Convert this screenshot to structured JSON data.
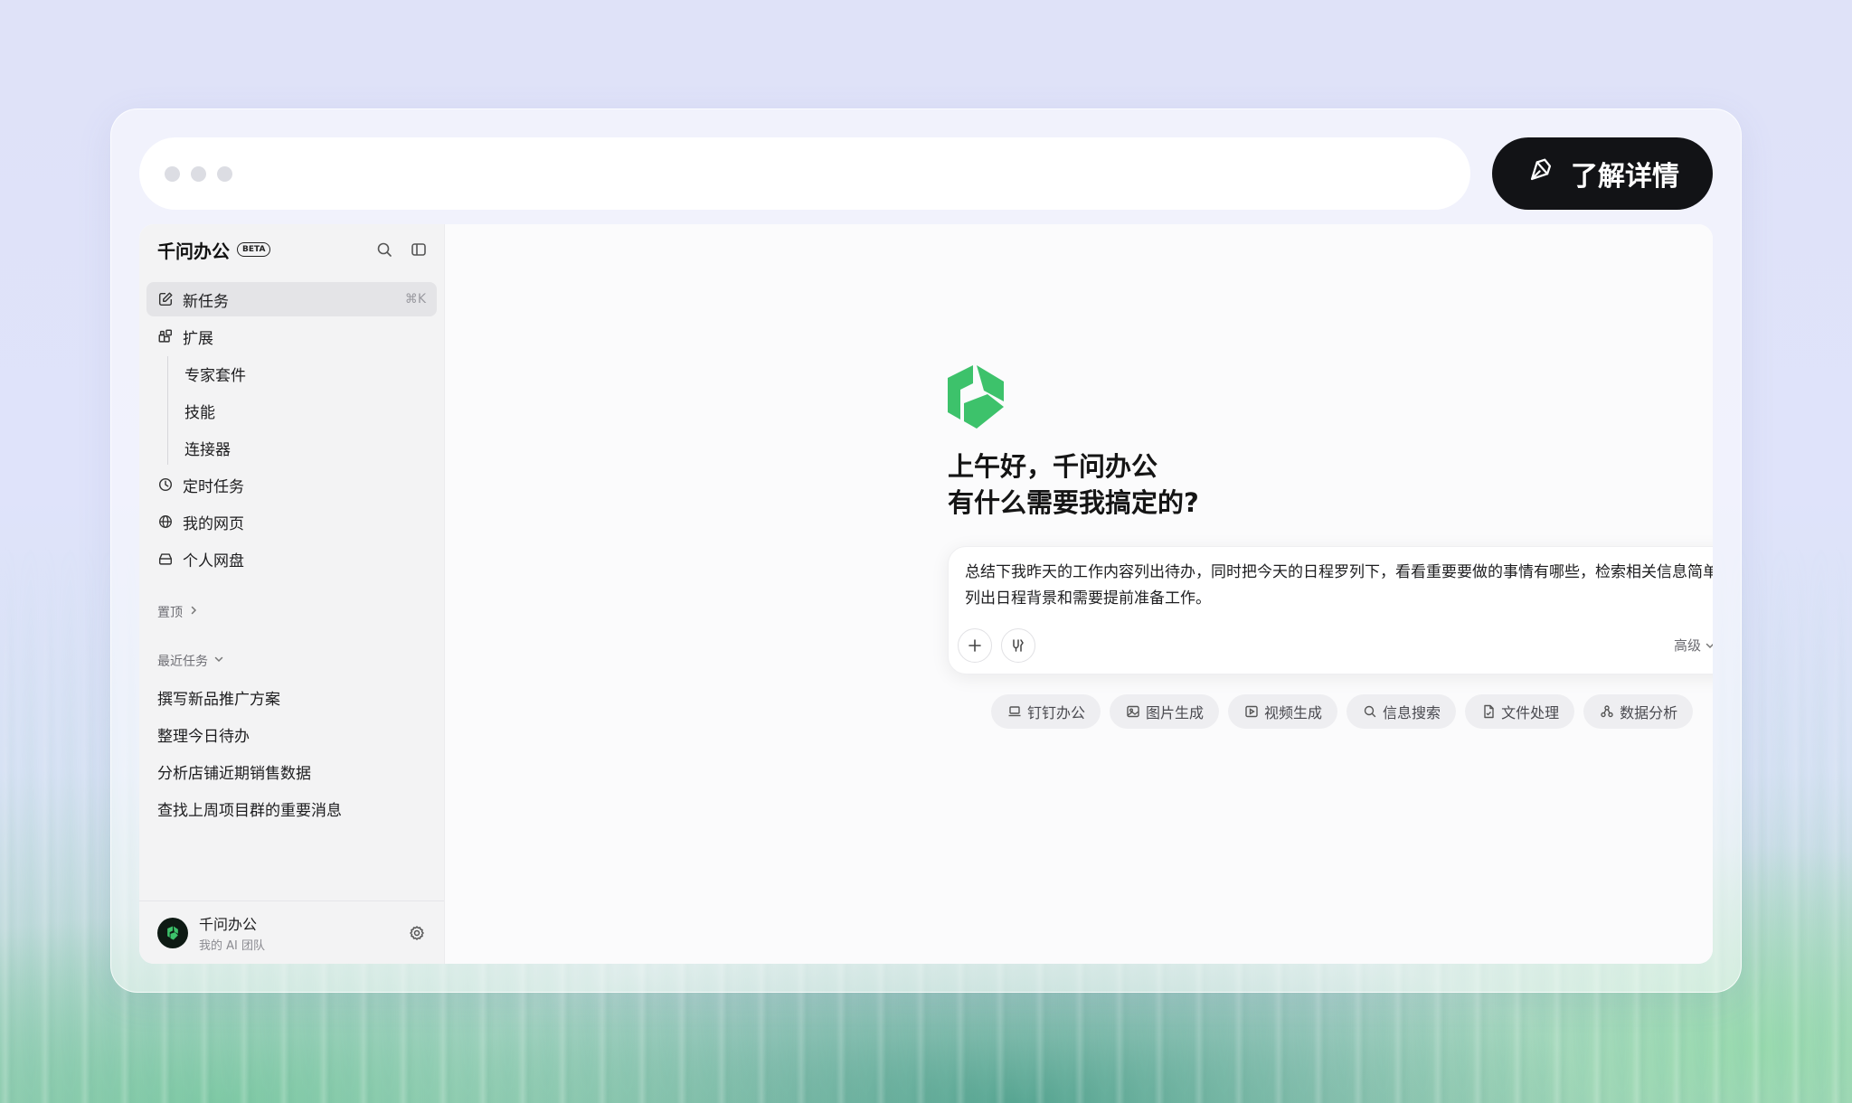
{
  "cta": {
    "label": "了解详情",
    "icon": "pen-sparkle-icon"
  },
  "sidebar": {
    "brand": "千问办公",
    "badge": "BETA",
    "nav": [
      {
        "label": "新任务",
        "icon": "edit-icon",
        "shortcut": "⌘K",
        "active": true
      },
      {
        "label": "扩展",
        "icon": "extensions-icon"
      }
    ],
    "extensions_sub": [
      "专家套件",
      "技能",
      "连接器"
    ],
    "nav2": [
      {
        "label": "定时任务",
        "icon": "clock-icon"
      },
      {
        "label": "我的网页",
        "icon": "globe-icon"
      },
      {
        "label": "个人网盘",
        "icon": "drive-icon"
      }
    ],
    "pinned_label": "置顶",
    "recent_label": "最近任务",
    "recent": [
      "撰写新品推广方案",
      "整理今日待办",
      "分析店铺近期销售数据",
      "查找上周项目群的重要消息"
    ],
    "footer": {
      "name": "千问办公",
      "team": "我的 AI 团队"
    }
  },
  "main": {
    "greeting_line1": "上午好，千问办公",
    "greeting_line2": "有什么需要我搞定的?",
    "composer_text": "总结下我昨天的工作内容列出待办，同时把今天的日程罗列下，看看重要要做的事情有哪些，检索相关信息简单一句话列出日程背景和需要提前准备工作。",
    "level_label": "高级",
    "chips": [
      {
        "label": "钉钉办公",
        "icon": "laptop-icon"
      },
      {
        "label": "图片生成",
        "icon": "image-icon"
      },
      {
        "label": "视频生成",
        "icon": "video-icon"
      },
      {
        "label": "信息搜索",
        "icon": "search-icon"
      },
      {
        "label": "文件处理",
        "icon": "file-icon"
      },
      {
        "label": "数据分析",
        "icon": "chart-icon"
      }
    ]
  },
  "colors": {
    "brand_green": "#3dc26b",
    "dark": "#121316"
  }
}
